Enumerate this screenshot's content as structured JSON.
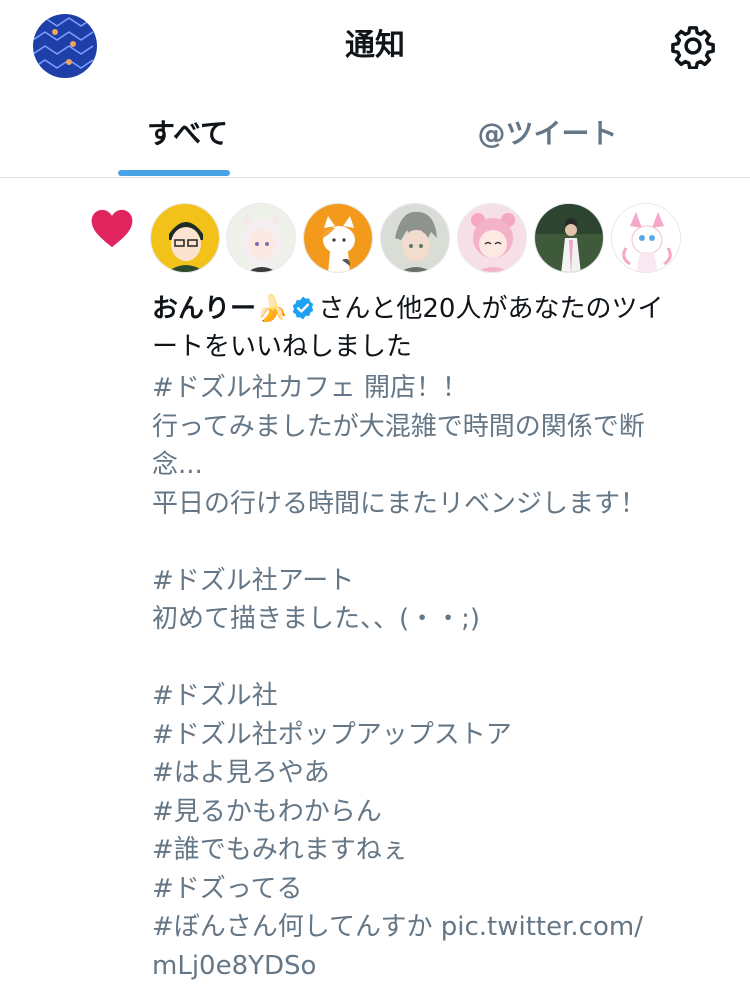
{
  "header": {
    "title": "通知",
    "profile_avatar": "profile-avatar",
    "settings_icon": "gear-icon"
  },
  "tabs": [
    {
      "label": "すべて",
      "active": true
    },
    {
      "label": "@ツイート",
      "active": false
    }
  ],
  "colors": {
    "accent": "#4aa3e6",
    "like": "#e0245e",
    "secondary_text": "#657786",
    "verified": "#1da1f2"
  },
  "notification": {
    "type_icon": "heart-icon",
    "likers": [
      "liker-avatar",
      "liker-avatar",
      "liker-avatar",
      "liker-avatar",
      "liker-avatar",
      "liker-avatar",
      "liker-avatar"
    ],
    "user_name": "おんりー🍌",
    "summary_line1_rest": "さんと他20人があなたのツイ",
    "summary_line2": "ートをいいねしました",
    "tweet_lines": [
      "#ドズル社カフェ 開店！！",
      "行ってみましたが大混雑で時間の関係で断",
      "念...",
      "平日の行ける時間にまたリベンジします！",
      "",
      "#ドズル社アート",
      "初めて描きました、、(・・;)",
      "",
      "#ドズル社",
      "#ドズル社ポップアップストア",
      "#はよ見ろやあ",
      "#見るかもわからん",
      "#誰でもみれますねぇ",
      "#ドズってる",
      "#ぼんさん何してんすか pic.twitter.com/",
      "mLj0e8YDSo"
    ]
  }
}
